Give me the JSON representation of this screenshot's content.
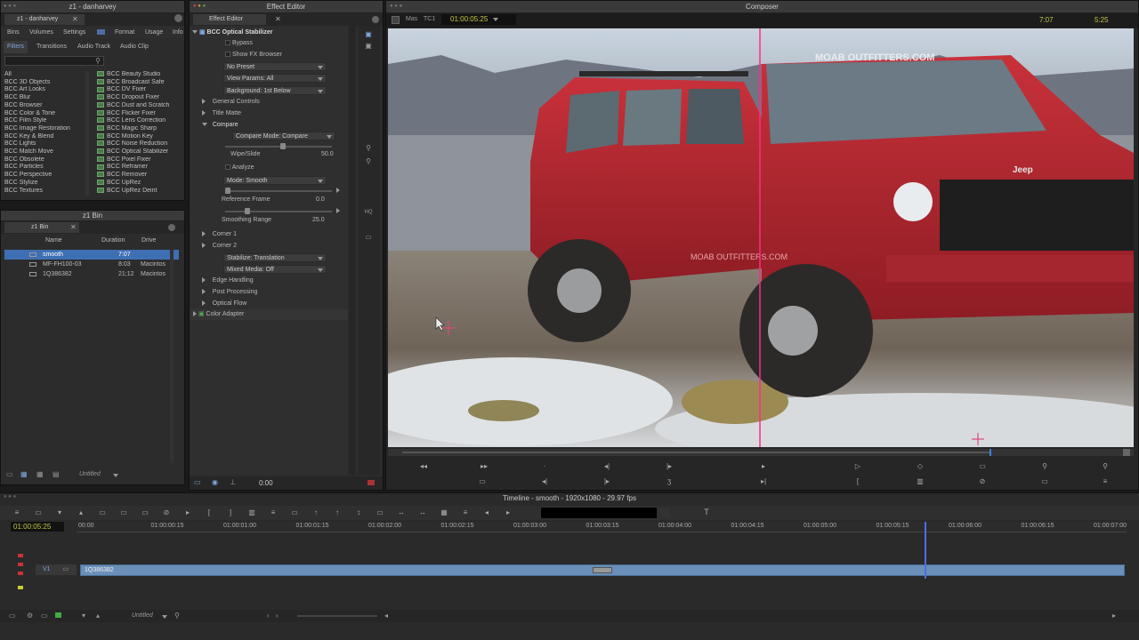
{
  "bin_window": {
    "title": "z1 - danharvey",
    "tab": "z1 - danharvey",
    "menu_tabs": [
      "Bins",
      "Volumes",
      "Settings",
      "Format",
      "Usage",
      "Info"
    ],
    "sub_tabs": [
      "Filters",
      "Transitions",
      "Audio Track",
      "Audio Clip"
    ],
    "categories": [
      "All",
      "BCC 3D Objects",
      "BCC Art Looks",
      "BCC Blur",
      "BCC Browser",
      "BCC Color & Tone",
      "BCC Film Style",
      "BCC Image Restoration",
      "BCC Key & Blend",
      "BCC Lights",
      "BCC Match Move",
      "BCC Obsolete",
      "BCC Particles",
      "BCC Perspective",
      "BCC Stylize",
      "BCC Textures"
    ],
    "effects": [
      "BCC Beauty Studio",
      "BCC Broadcast Safe",
      "BCC DV Fixer",
      "BCC Dropout Fixer",
      "BCC Dust and Scratch",
      "BCC Flicker Fixer",
      "BCC Lens Correction",
      "BCC Magic Sharp",
      "BCC Motion Key",
      "BCC Noise Reduction",
      "BCC Optical Stabilizer",
      "BCC Pixel Fixer",
      "BCC Reframer",
      "BCC Remover",
      "BCC UpRez",
      "BCC UpRez Deint"
    ]
  },
  "z1_bin": {
    "title": "z1 Bin",
    "tab": "z1 Bin",
    "columns": [
      "Name",
      "Duration",
      "Drive"
    ],
    "rows": [
      {
        "name": "smooth",
        "duration": "7:07",
        "drive": ""
      },
      {
        "name": "MF-FH100-03",
        "duration": "8:03",
        "drive": "Macintos"
      },
      {
        "name": "1Q386382",
        "duration": "21;12",
        "drive": "Macintos"
      }
    ],
    "footer": "Untitled"
  },
  "effect_editor": {
    "title": "Effect Editor",
    "tab": "Effect Editor",
    "effect_name": "BCC Optical Stabilizer",
    "bypass": "Bypass",
    "show_fx_browser": "Show FX Browser",
    "preset": "No Preset",
    "view_params": "View Params: All",
    "background": "Background: 1st Below",
    "general_controls": "General Controls",
    "title_matte": "Title Matte",
    "compare": "Compare",
    "compare_mode": "Compare Mode: Compare",
    "wipe_label": "Wipe/Slide",
    "wipe_value": "50.0",
    "analyze": "Analyze",
    "mode": "Mode: Smooth",
    "ref_frame_label": "Reference Frame",
    "ref_frame_value": "0.0",
    "smoothing_label": "Smoothing Range",
    "smoothing_value": "25.0",
    "corner1": "Corner 1",
    "corner2": "Corner 2",
    "stabilize": "Stabilize: Translation",
    "mixed_media": "Mixed Media: Off",
    "edge_handling": "Edge Handling",
    "post_processing": "Post Processing",
    "optical_flow": "Optical Flow",
    "color_adapter": "Color Adapter",
    "timecode": "0:00"
  },
  "composer": {
    "title": "Composer",
    "track_label": "Mas",
    "tc_label": "TC1",
    "timecode": "01:00:05:25",
    "duration": "7:07",
    "position": "5:25",
    "image_text_left": "MOAB OUTFITTERS.COM",
    "image_text_top": "MOAB OUTFITTERS.COM",
    "image_text_grille": "Jeep"
  },
  "timeline": {
    "title": "Timeline - smooth - 1920x1080 - 29.97 fps",
    "timecode": "01:00:05:25",
    "ruler": [
      "00:00",
      "01:00:00:15",
      "01:00:01:00",
      "01:00:01:15",
      "01:00:02:00",
      "01:00:02:15",
      "01:00:03:00",
      "01:00:03:15",
      "01:00:04:00",
      "01:00:04:15",
      "01:00:05:00",
      "01:00:05:15",
      "01:00:06:00",
      "01:00:06:15",
      "01:00:07:00"
    ],
    "track": "V1",
    "clip": "1Q386382",
    "footer": "Untitled"
  },
  "colors": {
    "accent": "#4a6fa5",
    "selection": "#3f6fb3",
    "playhead": "#ff2a8a",
    "clip": "#6a8fb8",
    "timecode": "#c8c84a"
  }
}
